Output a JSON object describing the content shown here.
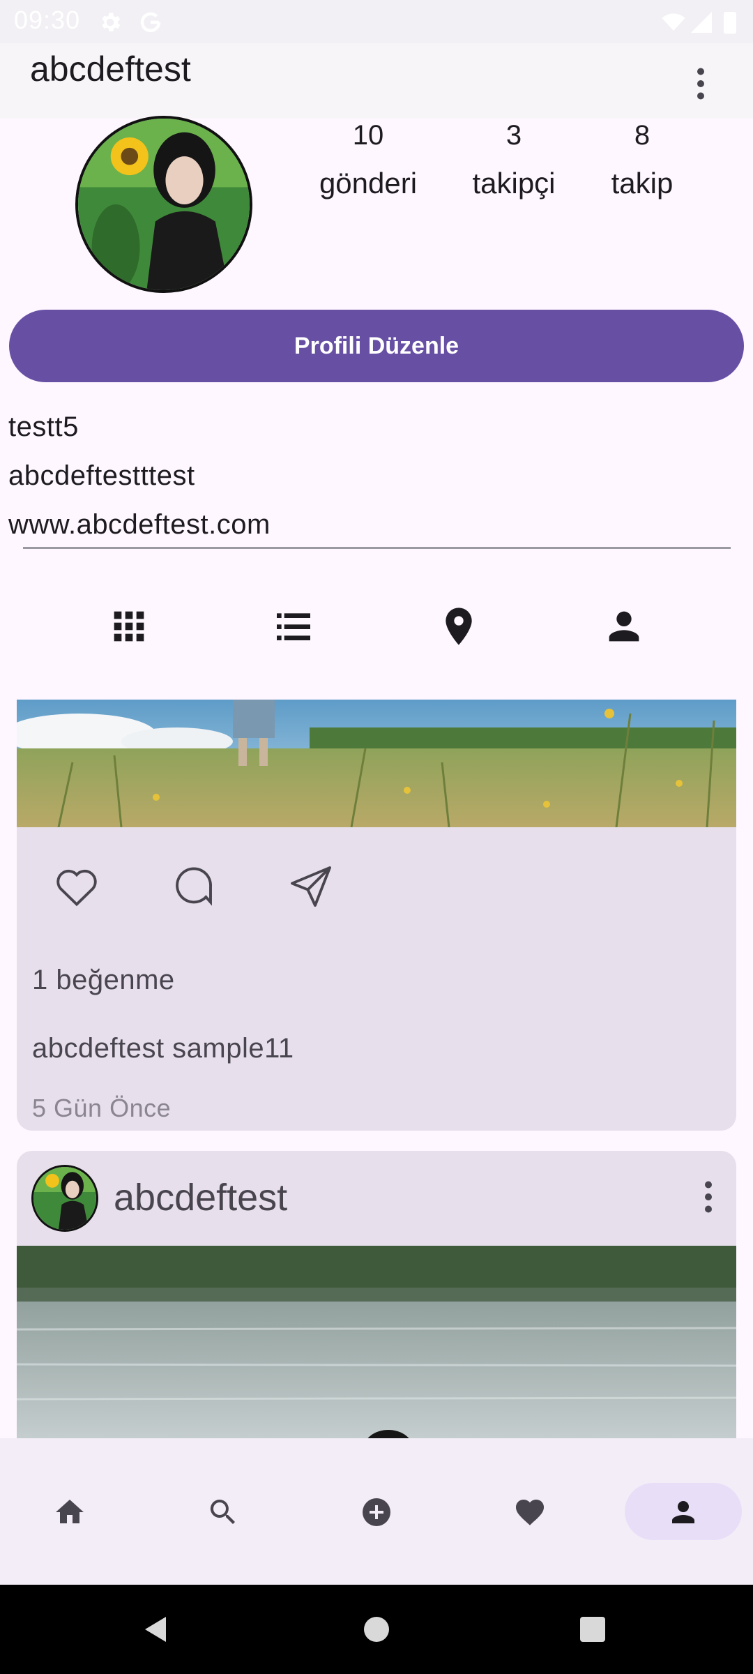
{
  "status_bar": {
    "time": "09:30"
  },
  "app_bar": {
    "title": "abcdeftest"
  },
  "profile": {
    "stats": [
      {
        "value": "10",
        "label": "gönderi"
      },
      {
        "value": "3",
        "label": "takipçi"
      },
      {
        "value": "8",
        "label": "takip"
      }
    ],
    "edit_button": "Profili Düzenle",
    "bio": {
      "name": "testt5",
      "description": "abcdeftestttest",
      "website": "www.abcdeftest.com"
    }
  },
  "tabs": [
    {
      "icon": "grid-icon"
    },
    {
      "icon": "list-icon"
    },
    {
      "icon": "location-pin-icon"
    },
    {
      "icon": "person-icon"
    }
  ],
  "posts": [
    {
      "likes": "1 beğenme",
      "caption": "abcdeftest sample11",
      "time_ago": "5 Gün Önce"
    },
    {
      "username": "abcdeftest"
    }
  ],
  "bottom_nav": [
    {
      "icon": "home-icon"
    },
    {
      "icon": "search-icon"
    },
    {
      "icon": "add-circle-icon"
    },
    {
      "icon": "heart-icon"
    },
    {
      "icon": "profile-icon",
      "selected": true
    }
  ],
  "colors": {
    "primary": "#6750a4",
    "card_bg": "#e7e0ec",
    "selected_pill": "#e8def8"
  }
}
